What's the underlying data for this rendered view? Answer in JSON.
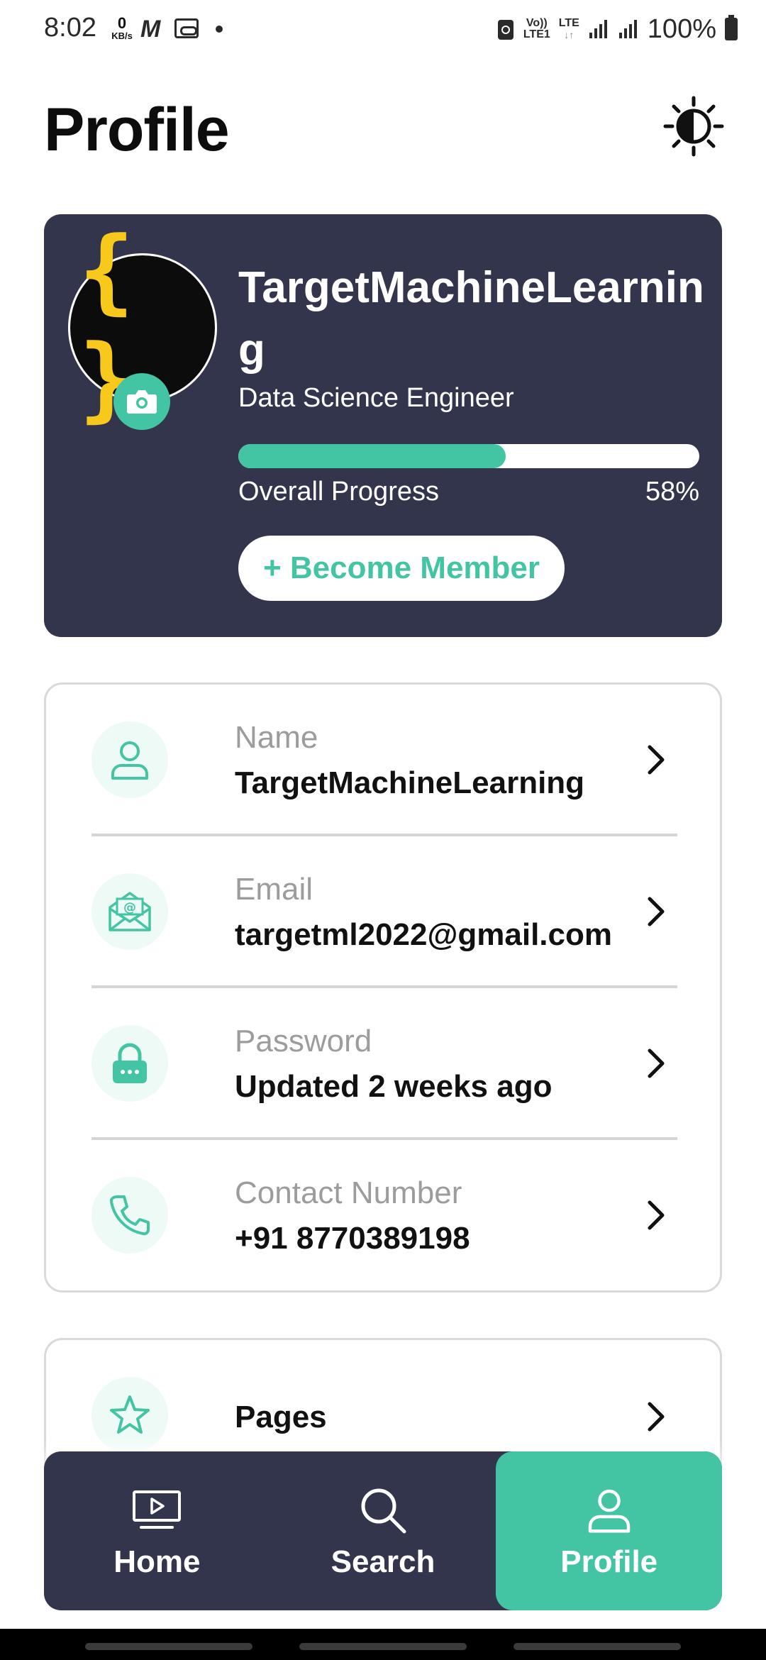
{
  "status_bar": {
    "time": "8:02",
    "net_speed_value": "0",
    "net_speed_unit": "KB/s",
    "carrier_icon": "M",
    "volte_top": "Vo))",
    "volte_bottom": "LTE1",
    "lte_label": "LTE",
    "battery_percent": "100%"
  },
  "header": {
    "title": "Profile",
    "theme_toggle_icon": "brightness-icon"
  },
  "profile": {
    "avatar_text": "{ }",
    "name": "TargetMachineLearning",
    "role": "Data Science Engineer",
    "progress": 0.58,
    "progress_label": "Overall Progress",
    "progress_value": "58%",
    "member_button": "+ Become Member"
  },
  "info_rows": [
    {
      "icon": "user-icon",
      "label": "Name",
      "value": "TargetMachineLearning"
    },
    {
      "icon": "email-icon",
      "label": "Email",
      "value": "targetml2022@gmail.com"
    },
    {
      "icon": "lock-icon",
      "label": "Password",
      "value": "Updated 2 weeks ago"
    },
    {
      "icon": "phone-icon",
      "label": "Contact Number",
      "value": "+91 8770389198"
    }
  ],
  "pages_row": {
    "icon": "star-icon",
    "value": "Pages"
  },
  "nav": [
    {
      "label": "Home",
      "icon": "tv-icon",
      "active": false
    },
    {
      "label": "Search",
      "icon": "search-icon",
      "active": false
    },
    {
      "label": "Profile",
      "icon": "user-icon",
      "active": true
    }
  ],
  "colors": {
    "accent": "#43c4a3",
    "card_dark": "#33354d",
    "avatar_brace": "#f7c91c"
  }
}
